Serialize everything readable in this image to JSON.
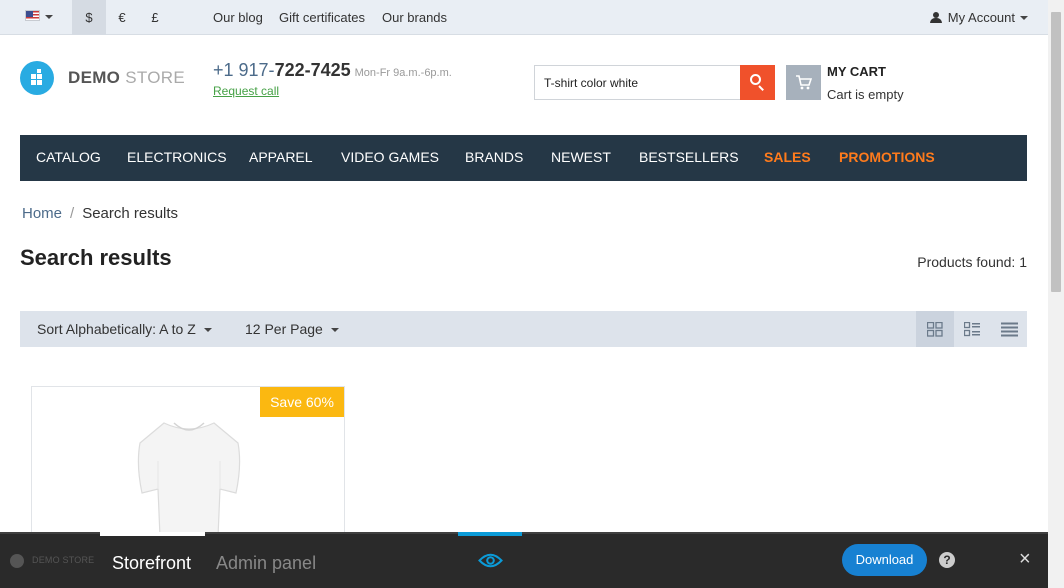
{
  "topbar": {
    "language_icon": "us-flag-icon",
    "currencies": [
      "$",
      "€",
      "£"
    ],
    "active_currency": "$",
    "links": [
      "Our blog",
      "Gift certificates",
      "Our brands"
    ],
    "account_label": "My Account"
  },
  "header": {
    "logo_bold": "DEMO",
    "logo_light": "STORE",
    "phone_prefix": "+1 917-",
    "phone_number": "722-7425",
    "hours": "Mon-Fr 9a.m.-6p.m.",
    "request_call": "Request call",
    "search_value": "T-shirt color white",
    "cart_title": "MY CART",
    "cart_status": "Cart is empty"
  },
  "nav": {
    "items": [
      "CATALOG",
      "ELECTRONICS",
      "APPAREL",
      "VIDEO GAMES",
      "BRANDS",
      "NEWEST",
      "BESTSELLERS",
      "SALES",
      "PROMOTIONS"
    ],
    "highlight_color": "#ff7b1c"
  },
  "breadcrumb": {
    "home": "Home",
    "separator": "/",
    "current": "Search results"
  },
  "page": {
    "title": "Search results",
    "products_found": "Products found: 1"
  },
  "sorting": {
    "sort_label": "Sort Alphabetically: A to Z",
    "per_page_label": "12 Per Page",
    "views": [
      "grid-view-icon",
      "list-view-icon",
      "compact-list-icon"
    ],
    "active_view": "grid-view-icon"
  },
  "products": [
    {
      "badge": "Save 60%",
      "image": "white-tshirt-image"
    }
  ],
  "bottom_panel": {
    "logo_text": "DEMO STORE",
    "tabs": [
      "Storefront",
      "Admin panel"
    ],
    "active_tab": "Storefront",
    "download_label": "Download",
    "help_label": "?",
    "close_label": "×"
  },
  "colors": {
    "accent_orange": "#f0512b",
    "nav_bg": "#253746",
    "badge": "#fbb811",
    "download": "#1781d2",
    "link_green": "#46a146"
  }
}
